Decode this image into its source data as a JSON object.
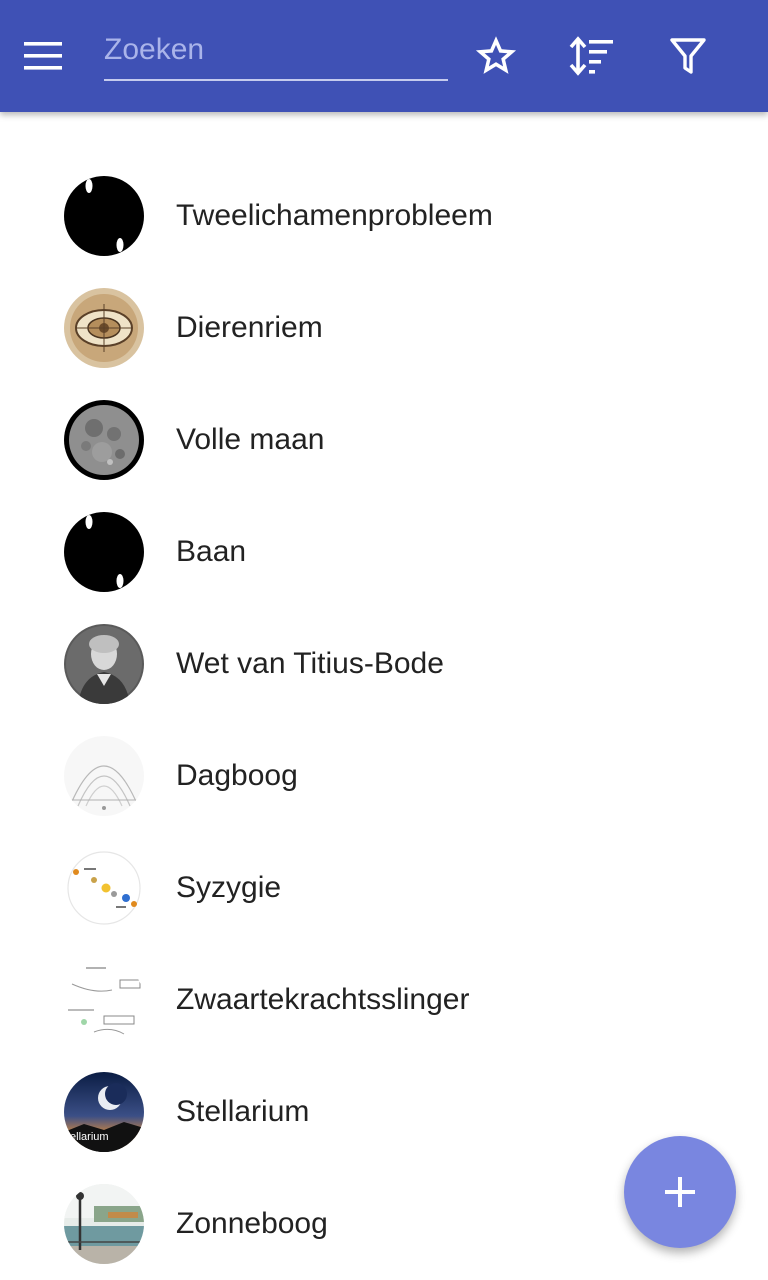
{
  "toolbar": {
    "search_placeholder": "Zoeken",
    "menu_icon": "menu-icon",
    "favorite_icon": "star-outline-icon",
    "sort_icon": "sort-icon",
    "filter_icon": "filter-icon",
    "background_color": "#3f51b5"
  },
  "articles": [
    {
      "title": "Tweelichamenprobleem",
      "thumbnail": "two-body-orbit-thumbnail"
    },
    {
      "title": "Dierenriem",
      "thumbnail": "zodiac-chart-thumbnail"
    },
    {
      "title": "Volle maan",
      "thumbnail": "full-moon-thumbnail"
    },
    {
      "title": "Baan",
      "thumbnail": "orbit-thumbnail"
    },
    {
      "title": "Wet van Titius-Bode",
      "thumbnail": "portrait-engraving-thumbnail"
    },
    {
      "title": "Dagboog",
      "thumbnail": "diurnal-arc-diagram-thumbnail"
    },
    {
      "title": "Syzygie",
      "thumbnail": "syzygy-diagram-thumbnail"
    },
    {
      "title": "Zwaartekrachtsslinger",
      "thumbnail": "gravity-assist-diagram-thumbnail"
    },
    {
      "title": "Stellarium",
      "thumbnail": "stellarium-logo-thumbnail",
      "thumbnail_text": "tellarium"
    },
    {
      "title": "Zonneboog",
      "thumbnail": "sundial-photo-thumbnail"
    }
  ],
  "fab": {
    "icon": "add-icon",
    "color": "#7986e0"
  }
}
